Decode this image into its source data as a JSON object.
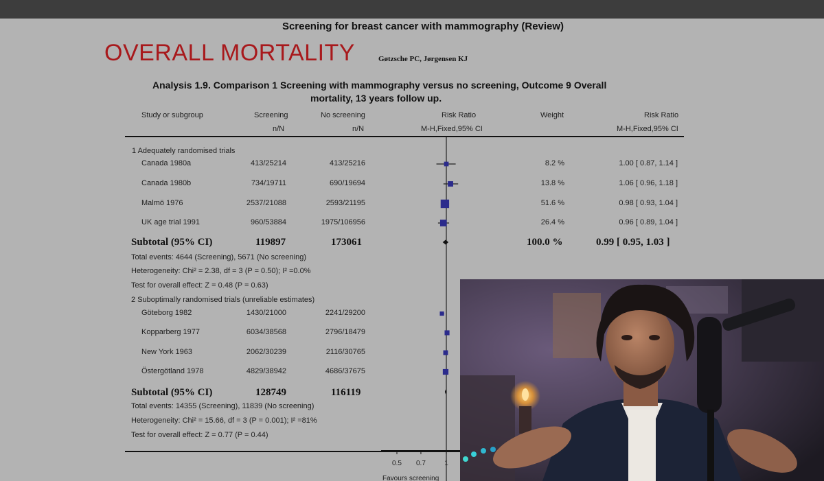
{
  "document": {
    "review_title": "Screening for breast cancer with mammography (Review)",
    "overlay_title": "OVERALL MORTALITY",
    "authors": "Gøtzsche PC, Jørgensen KJ",
    "analysis_line1": "Analysis 1.9.   Comparison 1 Screening with mammography versus no screening, Outcome 9 Overall",
    "analysis_line2": "mortality, 13 years follow up.",
    "title_color": "#a8191c"
  },
  "table": {
    "headers": {
      "study": "Study or subgroup",
      "screening": "Screening",
      "screening_sub": "n/N",
      "no_screening": "No screening",
      "no_screening_sub": "n/N",
      "risk_ratio": "Risk Ratio",
      "risk_ratio_sub": "M-H,Fixed,95% CI",
      "weight": "Weight",
      "risk_ratio2": "Risk Ratio",
      "risk_ratio2_sub": "M-H,Fixed,95% CI"
    },
    "group1": {
      "label": "1 Adequately randomised trials",
      "subtotal_label": "Subtotal (95% CI)",
      "subtotal_screening": "119897",
      "subtotal_no_screening": "173061",
      "subtotal_weight": "100.0 %",
      "subtotal_rr": "0.99 [ 0.95, 1.03 ]",
      "events": "Total events: 4644 (Screening), 5671 (No screening)",
      "heterogeneity": "Heterogeneity: Chi² = 2.38, df = 3 (P = 0.50); I² =0.0%",
      "test": "Test for overall effect: Z = 0.48 (P = 0.63)"
    },
    "group2": {
      "label": "2 Suboptimally randomised trials (unreliable estimates)",
      "subtotal_label": "Subtotal (95% CI)",
      "subtotal_screening": "128749",
      "subtotal_no_screening": "116119",
      "events": "Total events: 14355 (Screening), 11839 (No screening)",
      "heterogeneity": "Heterogeneity: Chi² = 15.66, df = 3 (P = 0.001); I² =81%",
      "test": "Test for overall effect: Z = 0.77 (P = 0.44)"
    },
    "footer": {
      "favours": "Favours screening"
    }
  },
  "chart_data": {
    "type": "forest",
    "x_scale": "log",
    "x_ticks": [
      "0.5",
      "0.7",
      "1"
    ],
    "xlim": [
      0.5,
      1.25
    ],
    "reference_line": 1,
    "colors": {
      "square": "#2b2b8c",
      "line": "#222222"
    },
    "studies": [
      {
        "group": 1,
        "name": "Canada 1980a",
        "screening": "413/25214",
        "no_screening": "413/25216",
        "weight": "8.2 %",
        "rr_text": "1.00 [ 0.87, 1.14 ]",
        "rr": 1.0,
        "lo": 0.87,
        "hi": 1.14,
        "w": 8.2
      },
      {
        "group": 1,
        "name": "Canada 1980b",
        "screening": "734/19711",
        "no_screening": "690/19694",
        "weight": "13.8 %",
        "rr_text": "1.06 [ 0.96, 1.18 ]",
        "rr": 1.06,
        "lo": 0.96,
        "hi": 1.18,
        "w": 13.8
      },
      {
        "group": 1,
        "name": "Malmö 1976",
        "screening": "2537/21088",
        "no_screening": "2593/21195",
        "weight": "51.6 %",
        "rr_text": "0.98 [ 0.93, 1.04 ]",
        "rr": 0.98,
        "lo": 0.93,
        "hi": 1.04,
        "w": 51.6
      },
      {
        "group": 1,
        "name": "UK age trial 1991",
        "screening": "960/53884",
        "no_screening": "1975/106956",
        "weight": "26.4 %",
        "rr_text": "0.96 [ 0.89, 1.04 ]",
        "rr": 0.96,
        "lo": 0.89,
        "hi": 1.04,
        "w": 26.4
      },
      {
        "group": 2,
        "name": "Göteborg 1982",
        "screening": "1430/21000",
        "no_screening": "2241/29200",
        "weight": "",
        "rr_text": "",
        "rr": 0.94,
        "lo": 0.92,
        "hi": 0.97,
        "w": 6
      },
      {
        "group": 2,
        "name": "Kopparberg 1977",
        "screening": "6034/38568",
        "no_screening": "2796/18479",
        "weight": "",
        "rr_text": "",
        "rr": 1.01,
        "lo": 1.0,
        "hi": 1.02,
        "w": 10
      },
      {
        "group": 2,
        "name": "New York 1963",
        "screening": "2062/30239",
        "no_screening": "2116/30765",
        "weight": "",
        "rr_text": "",
        "rr": 0.99,
        "lo": 0.97,
        "hi": 1.01,
        "w": 9
      },
      {
        "group": 2,
        "name": "Östergötland 1978",
        "screening": "4829/38942",
        "no_screening": "4686/37675",
        "weight": "",
        "rr_text": "",
        "rr": 0.99,
        "lo": 0.98,
        "hi": 1.0,
        "w": 16
      }
    ],
    "subtotals": [
      {
        "group": 1,
        "rr": 0.99,
        "lo": 0.95,
        "hi": 1.03
      },
      {
        "group": 2,
        "rr": 0.99,
        "lo": 0.98,
        "hi": 1.0
      }
    ]
  },
  "video_overlay": {
    "description_icon": "presenter-video-icon"
  }
}
